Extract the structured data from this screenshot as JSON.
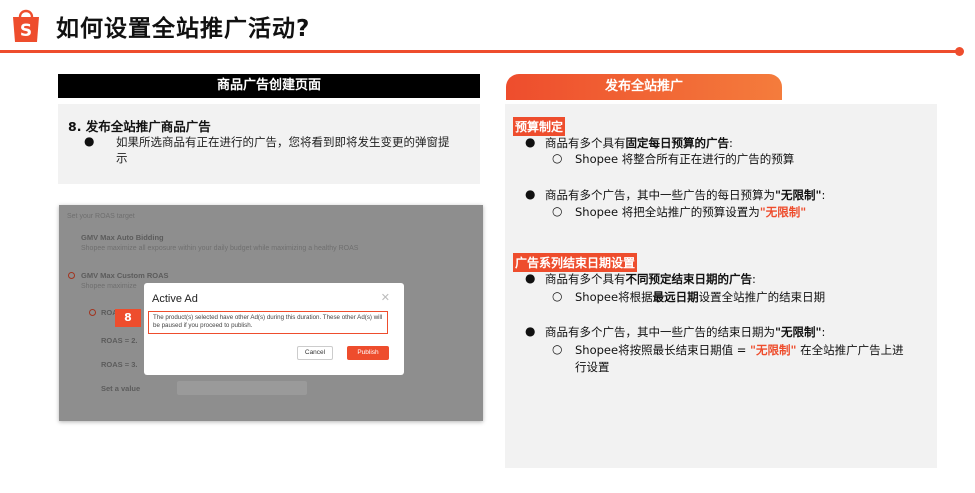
{
  "page": {
    "title": "如何设置全站推广活动?",
    "brand_color": "#ee4d2d"
  },
  "left": {
    "header": "商品广告创建页面",
    "step_title": "8. 发布全站推广商品广告",
    "step_text": "如果所选商品有正在进行的广告，您将看到即将发生变更的弹窗提示"
  },
  "screenshot": {
    "roas_target_label": "Set your ROAS target",
    "option1_title": "GMV Max Auto Bidding",
    "option1_desc": "Shopee maximize all exposure within your daily budget while maximizing a healthy ROAS",
    "option2_title": "GMV Max Custom ROAS",
    "option2_desc": "Shopee maximize",
    "roas_option_a": "ROA",
    "roas_option_b": "ROAS = 2.",
    "roas_option_c": "ROAS = 3.",
    "set_value": "Set a value",
    "step_badge": "8",
    "modal": {
      "title": "Active Ad",
      "message": "The product(s) selected have other Ad(s) during this duration. These other Ad(s) will be paused if you proceed to publish.",
      "cancel": "Cancel",
      "publish": "Publish"
    }
  },
  "right": {
    "header": "发布全站推广",
    "budget": {
      "title": "预算制定",
      "item1": {
        "pre": "商品有多个具有",
        "bold": "固定每日预算的广告",
        "post": ":"
      },
      "item1_sub": "Shopee 将整合所有正在进行的广告的预算",
      "item2": {
        "pre": "商品有多个广告，其中一些广告的每日预算为",
        "bold": "\"无限制\"",
        "post": ":"
      },
      "item2_sub": {
        "pre": "Shopee 将把全站推广的预算设置为",
        "hl": "\"无限制\""
      }
    },
    "end_date": {
      "title": "广告系列结束日期设置",
      "item1": {
        "pre": "商品有多个具有",
        "bold": "不同预定结束日期的广告",
        "post": ":"
      },
      "item1_sub": {
        "pre": "Shopee将根据",
        "bold": "最远日期",
        "post": "设置全站推广的结束日期"
      },
      "item2": {
        "pre": "商品有多个广告，其中一些广告的结束日期为",
        "bold": "\"无限制\"",
        "post": ":"
      },
      "item2_sub": {
        "pre": "Shopee将按照最长结束日期值 = ",
        "hl": "\"无限制\"",
        "post": " 在全站推广广告上进",
        "line2": "行设置"
      }
    }
  },
  "bullets": {
    "main": "●",
    "sub": "○"
  }
}
